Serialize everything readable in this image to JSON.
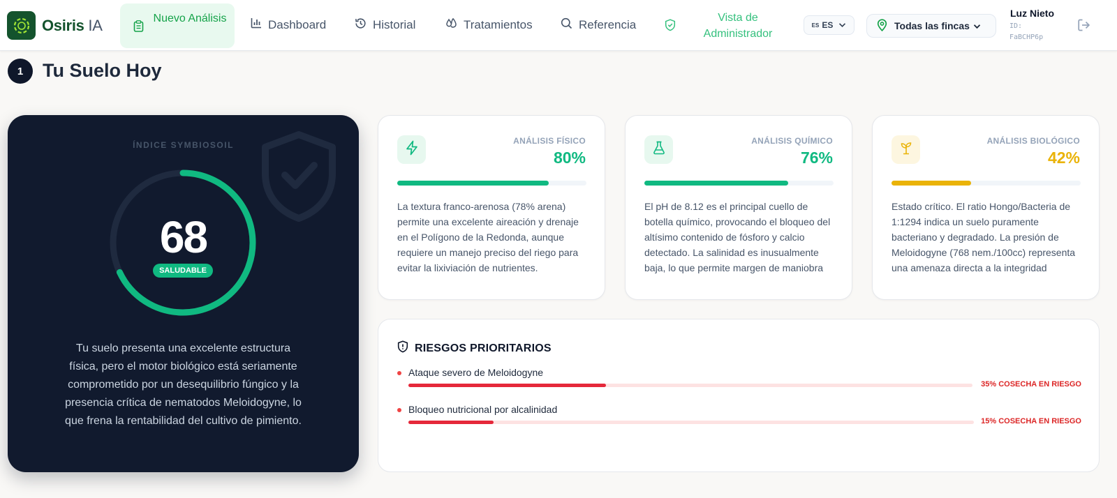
{
  "nav": {
    "brand_name": "Osiris",
    "brand_suffix": "IA",
    "new_analysis": "Nuevo Análisis",
    "dashboard": "Dashboard",
    "historial": "Historial",
    "tratamientos": "Tratamientos",
    "referencia": "Referencia",
    "admin": "Vista de Administrador",
    "lang_flag": "ES",
    "lang_code": "ES",
    "farm_selector": "Todas las fincas",
    "user_name": "Luz Nieto",
    "user_id": "ID: FaBCHP6p"
  },
  "section": {
    "step": "1",
    "title": "Tu Suelo Hoy"
  },
  "index_card": {
    "title": "ÍNDICE SYMBIOSOIL",
    "score": "68",
    "score_value": 68,
    "status": "SALUDABLE",
    "summary": "Tu suelo presenta una excelente estructura física, pero el motor biológico está seriamente comprometido por un desequilibrio fúngico y la presencia crítica de nematodos Meloidogyne, lo que frena la rentabilidad del cultivo de pimiento.",
    "colors": {
      "bg": "#111a2e",
      "ring": "#10b981",
      "track": "#1f2a3f"
    }
  },
  "analyses": [
    {
      "label": "ANÁLISIS FÍSICO",
      "percent": "80%",
      "value": 80,
      "color": "#10b981",
      "icon_bg": "#e7f8ef",
      "icon": "lightning-icon",
      "description": "La textura franco-arenosa (78% arena) permite una excelente aireación y drenaje en el Polígono de la Redonda, aunque requiere un manejo preciso del riego para evitar la lixiviación de nutrientes."
    },
    {
      "label": "ANÁLISIS QUÍMICO",
      "percent": "76%",
      "value": 76,
      "color": "#10b981",
      "icon_bg": "#e7f8ef",
      "icon": "flask-icon",
      "description": "El pH de 8.12 es el principal cuello de botella químico, provocando el bloqueo del altísimo contenido de fósforo y calcio detectado. La salinidad es inusualmente baja, lo que permite margen de maniobra para enmiendas."
    },
    {
      "label": "ANÁLISIS BIOLÓGICO",
      "percent": "42%",
      "value": 42,
      "color": "#eab308",
      "icon_bg": "#fdf6e0",
      "icon": "sprout-icon",
      "description": "Estado crítico. El ratio Hongo/Bacteria de 1:1294 indica un suelo puramente bacteriano y degradado. La presión de Meloidogyne (768 nem./100cc) representa una amenaza directa a la integridad radicular del pimiento."
    }
  ],
  "risks": {
    "title": "RIESGOS PRIORITARIOS",
    "items": [
      {
        "name": "Ataque severo de Meloidogyne",
        "label": "35% COSECHA EN RIESGO",
        "value": 35
      },
      {
        "name": "Bloqueo nutricional por alcalinidad",
        "label": "15% COSECHA EN RIESGO",
        "value": 15
      }
    ]
  }
}
